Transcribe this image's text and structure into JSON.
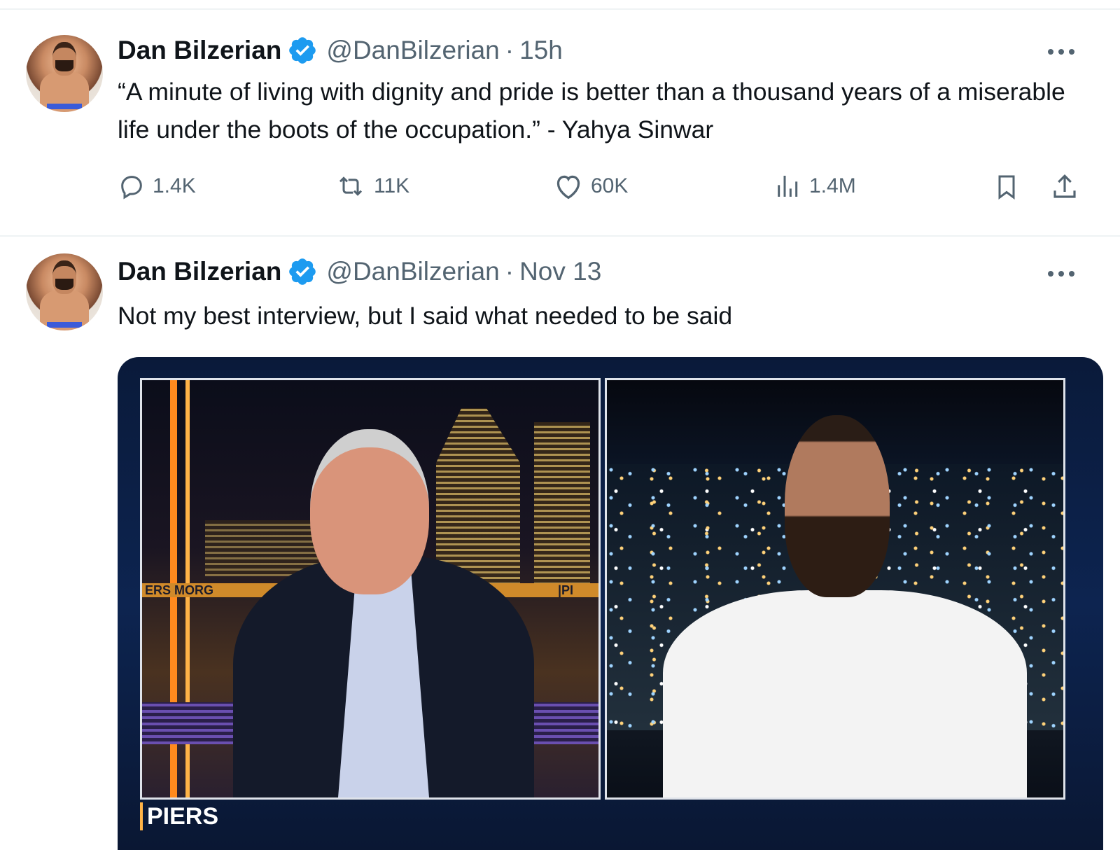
{
  "tweets": [
    {
      "author_name": "Dan Bilzerian",
      "handle": "@DanBilzerian",
      "separator": "·",
      "time": "15h",
      "text": "“A minute of living with dignity and pride is better than a thousand years of a miserable life under the boots of the occupation.” - Yahya Sinwar",
      "stats": {
        "replies": "1.4K",
        "reposts": "11K",
        "likes": "60K",
        "views": "1.4M"
      }
    },
    {
      "author_name": "Dan Bilzerian",
      "handle": "@DanBilzerian",
      "separator": "·",
      "time": "Nov 13",
      "text": "Not my best interview, but I said what needed to be said",
      "media": {
        "left_band_text": "ERS MORG",
        "left_band_text_right": "|PI",
        "lower_third": "PIERS"
      }
    }
  ],
  "icons": {
    "verified": "verified-badge-icon",
    "more": "more-horizontal-icon",
    "reply": "reply-icon",
    "repost": "repost-icon",
    "like": "heart-icon",
    "views": "views-chart-icon",
    "bookmark": "bookmark-icon",
    "share": "share-icon"
  },
  "colors": {
    "verified_blue": "#1d9bf0",
    "muted_text": "#536471",
    "primary_text": "#0f1419",
    "divider": "#eff3f4"
  }
}
